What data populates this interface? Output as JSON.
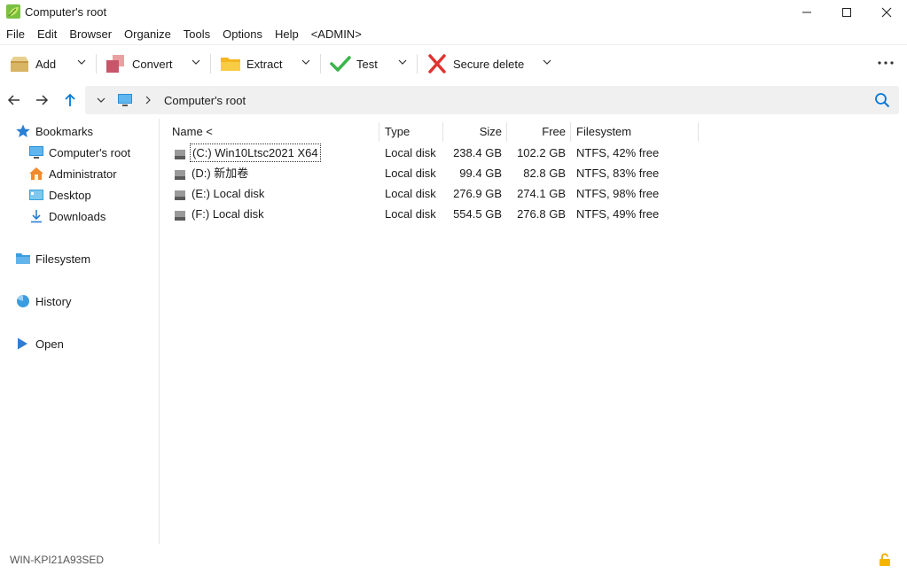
{
  "window": {
    "title": "Computer's root",
    "icon": "app-leaf-icon"
  },
  "menu": [
    "File",
    "Edit",
    "Browser",
    "Organize",
    "Tools",
    "Options",
    "Help",
    "<ADMIN>"
  ],
  "toolbar": {
    "add": "Add",
    "convert": "Convert",
    "extract": "Extract",
    "test": "Test",
    "secure_delete": "Secure delete"
  },
  "address": {
    "path": "Computer's root"
  },
  "sidebar": {
    "bookmarks": "Bookmarks",
    "bookmark_items": [
      "Computer's root",
      "Administrator",
      "Desktop",
      "Downloads"
    ],
    "filesystem": "Filesystem",
    "history": "History",
    "open": "Open"
  },
  "columns": {
    "name": "Name <",
    "type": "Type",
    "size": "Size",
    "free": "Free",
    "filesystem": "Filesystem"
  },
  "drives": [
    {
      "name": "(C:) Win10Ltsc2021 X64",
      "type": "Local disk",
      "size": "238.4 GB",
      "free": "102.2 GB",
      "fs": "NTFS, 42% free"
    },
    {
      "name": "(D:) 新加卷",
      "type": "Local disk",
      "size": "99.4 GB",
      "free": "82.8 GB",
      "fs": "NTFS, 83% free"
    },
    {
      "name": "(E:) Local disk",
      "type": "Local disk",
      "size": "276.9 GB",
      "free": "274.1 GB",
      "fs": "NTFS, 98% free"
    },
    {
      "name": "(F:) Local disk",
      "type": "Local disk",
      "size": "554.5 GB",
      "free": "276.8 GB",
      "fs": "NTFS, 49% free"
    }
  ],
  "status": {
    "computer": "WIN-KPI21A93SED"
  },
  "colors": {
    "accent": "#0a78d4",
    "address_bg": "#f0f0f0"
  }
}
